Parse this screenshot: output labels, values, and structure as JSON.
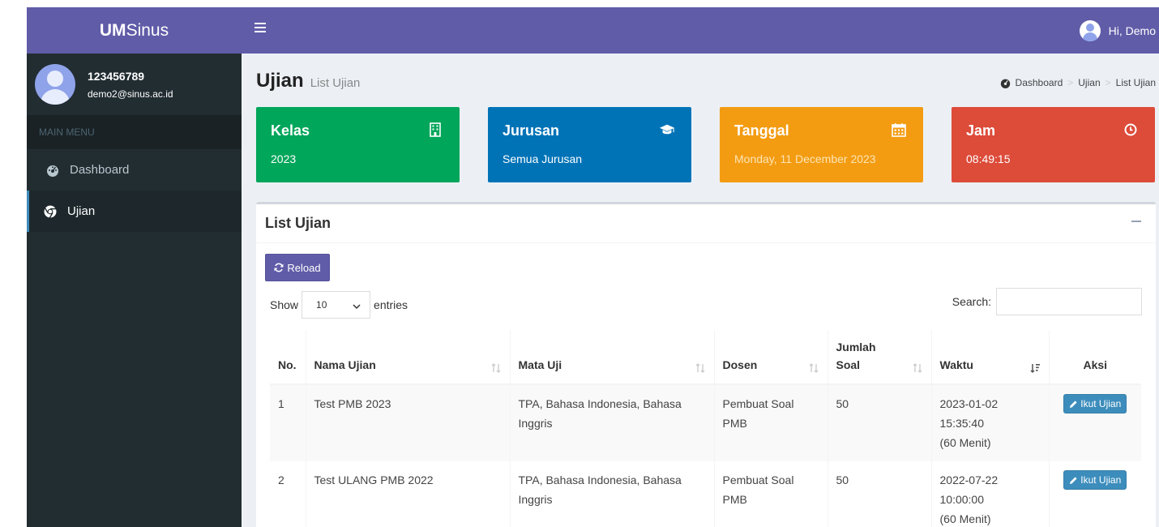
{
  "app": {
    "logo_bold": "UM",
    "logo_rest": "Sinus"
  },
  "user": {
    "id": "123456789",
    "email": "demo2@sinus.ac.id",
    "greeting": "Hi, Demo"
  },
  "sidebar": {
    "header": "MAIN MENU",
    "items": [
      {
        "label": "Dashboard",
        "icon": "dashboard-icon",
        "active": false
      },
      {
        "label": "Ujian",
        "icon": "chrome-icon",
        "active": true
      }
    ]
  },
  "page": {
    "title": "Ujian",
    "subtitle": "List Ujian"
  },
  "breadcrumb": [
    "Dashboard",
    "Ujian",
    "List Ujian"
  ],
  "info_boxes": [
    {
      "title": "Kelas",
      "value": "2023",
      "icon": "building-icon",
      "color": "#00a65a"
    },
    {
      "title": "Jurusan",
      "value": "Semua Jurusan",
      "icon": "graduation-cap-icon",
      "color": "#0073b7"
    },
    {
      "title": "Tanggal",
      "value": "Monday, 11 December 2023",
      "icon": "calendar-icon",
      "color": "#f39c12"
    },
    {
      "title": "Jam",
      "value": "08:49:15",
      "icon": "clock-icon",
      "color": "#dd4b39"
    }
  ],
  "panel": {
    "title": "List Ujian",
    "reload_label": "Reload",
    "show_label": "Show",
    "entries_value": "10",
    "entries_label": "entries",
    "search_label": "Search:"
  },
  "table": {
    "headers": [
      "No.",
      "Nama Ujian",
      "Mata Uji",
      "Dosen",
      "Jumlah Soal",
      "Waktu",
      "Aksi"
    ],
    "rows": [
      {
        "no": "1",
        "nama": "Test PMB 2023",
        "mata_uji": "TPA, Bahasa Indonesia, Bahasa Inggris",
        "dosen": "Pembuat Soal PMB",
        "jumlah": "50",
        "waktu_date": "2023-01-02",
        "waktu_time": "15:35:40",
        "waktu_durasi": "(60 Menit)",
        "aksi": "Ikut Ujian"
      },
      {
        "no": "2",
        "nama": "Test ULANG PMB 2022",
        "mata_uji": "TPA, Bahasa Indonesia, Bahasa Inggris",
        "dosen": "Pembuat Soal PMB",
        "jumlah": "50",
        "waktu_date": "2022-07-22",
        "waktu_time": "10:00:00",
        "waktu_durasi": "(60 Menit)",
        "aksi": "Ikut Ujian"
      }
    ]
  }
}
